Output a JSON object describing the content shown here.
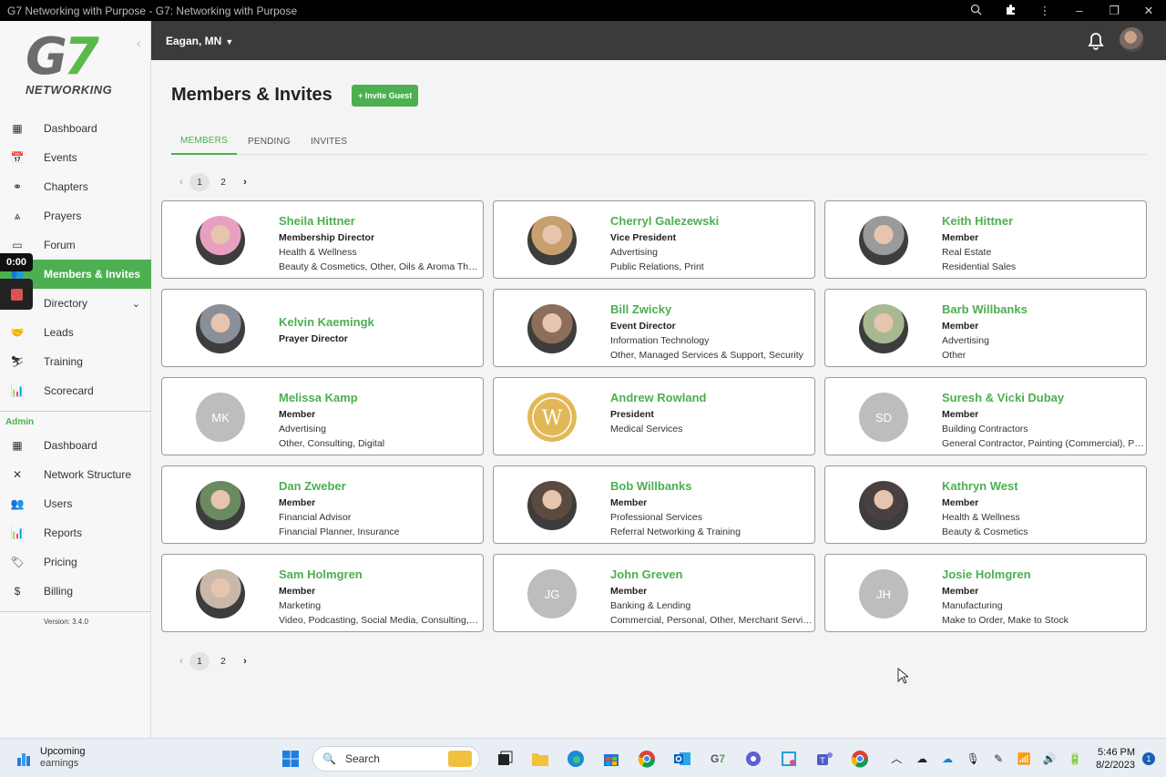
{
  "window": {
    "title": "G7 Networking with Purpose - G7: Networking with Purpose"
  },
  "sidebar": {
    "logo_text": "G7",
    "logo_sub": "NETWORKING",
    "items": [
      {
        "label": "Dashboard",
        "icon": "dashboard-icon"
      },
      {
        "label": "Events",
        "icon": "calendar-icon"
      },
      {
        "label": "Chapters",
        "icon": "chapters-icon"
      },
      {
        "label": "Prayers",
        "icon": "prayer-icon"
      },
      {
        "label": "Forum",
        "icon": "forum-icon"
      },
      {
        "label": "Members & Invites",
        "icon": "members-icon",
        "active": true
      },
      {
        "label": "Directory",
        "icon": "directory-icon"
      },
      {
        "label": "Leads",
        "icon": "handshake-icon"
      },
      {
        "label": "Training",
        "icon": "training-icon"
      },
      {
        "label": "Scorecard",
        "icon": "scorecard-icon"
      }
    ],
    "admin_label": "Admin",
    "admin_items": [
      {
        "label": "Dashboard",
        "icon": "dashboard-icon"
      },
      {
        "label": "Network Structure",
        "icon": "network-icon"
      },
      {
        "label": "Users",
        "icon": "users-icon"
      },
      {
        "label": "Reports",
        "icon": "reports-icon"
      },
      {
        "label": "Pricing",
        "icon": "pricing-icon"
      },
      {
        "label": "Billing",
        "icon": "billing-icon"
      }
    ],
    "version": "Version: 3.4.0"
  },
  "recorder": {
    "timer": "0:00"
  },
  "header": {
    "location": "Eagan, MN"
  },
  "main": {
    "title": "Members & Invites",
    "invite_button": "+ Invite Guest",
    "tabs": [
      "MEMBERS",
      "PENDING",
      "INVITES"
    ],
    "pages": [
      "1",
      "2"
    ],
    "members": [
      {
        "name": "Sheila Hittner",
        "role": "Membership Director",
        "line1": "Health & Wellness",
        "line2": "Beauty & Cosmetics, Other, Oils & Aroma Therapy",
        "avatar": "photo",
        "tone": "#e8a0c0"
      },
      {
        "name": "Cherryl Galezewski",
        "role": "Vice President",
        "line1": "Advertising",
        "line2": "Public Relations, Print",
        "avatar": "photo",
        "tone": "#c8a070"
      },
      {
        "name": "Keith Hittner",
        "role": "Member",
        "line1": "Real Estate",
        "line2": "Residential Sales",
        "avatar": "photo",
        "tone": "#9a9a9a"
      },
      {
        "name": "Kelvin Kaemingk",
        "role": "Prayer Director",
        "line1": "",
        "line2": "",
        "avatar": "photo",
        "tone": "#8a8f98"
      },
      {
        "name": "Bill Zwicky",
        "role": "Event Director",
        "line1": "Information Technology",
        "line2": "Other, Managed Services & Support, Security",
        "avatar": "photo",
        "tone": "#8c6e5a"
      },
      {
        "name": "Barb Willbanks",
        "role": "Member",
        "line1": "Advertising",
        "line2": "Other",
        "avatar": "photo",
        "tone": "#a8b890"
      },
      {
        "name": "Melissa Kamp",
        "role": "Member",
        "line1": "Advertising",
        "line2": "Other, Consulting, Digital",
        "avatar": "initials",
        "initials": "MK"
      },
      {
        "name": "Andrew Rowland",
        "role": "President",
        "line1": "Medical Services",
        "line2": "",
        "avatar": "logo",
        "initials": "W"
      },
      {
        "name": "Suresh & Vicki Dubay",
        "role": "Member",
        "line1": "Building Contractors",
        "line2": "General Contractor, Painting (Commercial), Painting (Residential)",
        "avatar": "initials",
        "initials": "SD"
      },
      {
        "name": "Dan Zweber",
        "role": "Member",
        "line1": "Financial Advisor",
        "line2": "Financial Planner, Insurance",
        "avatar": "photo",
        "tone": "#6a8a60"
      },
      {
        "name": "Bob Willbanks",
        "role": "Member",
        "line1": "Professional Services",
        "line2": "Referral Networking & Training",
        "avatar": "photo",
        "tone": "#5a4a40"
      },
      {
        "name": "Kathryn West",
        "role": "Member",
        "line1": "Health & Wellness",
        "line2": "Beauty & Cosmetics",
        "avatar": "photo",
        "tone": "#4a4040"
      },
      {
        "name": "Sam Holmgren",
        "role": "Member",
        "line1": "Marketing",
        "line2": "Video, Podcasting, Social Media, Consulting, Digital",
        "avatar": "photo",
        "tone": "#c8b8a8"
      },
      {
        "name": "John Greven",
        "role": "Member",
        "line1": "Banking & Lending",
        "line2": "Commercial, Personal, Other, Merchant Services",
        "avatar": "initials",
        "initials": "JG"
      },
      {
        "name": "Josie Holmgren",
        "role": "Member",
        "line1": "Manufacturing",
        "line2": "Make to Order, Make to Stock",
        "avatar": "initials",
        "initials": "JH"
      }
    ]
  },
  "taskbar": {
    "weather_title": "Upcoming",
    "weather_sub": "earnings",
    "search_placeholder": "Search",
    "time": "5:46 PM",
    "date": "8/2/2023",
    "notifications": "1"
  },
  "colors": {
    "accent": "#4caf50",
    "header_bg": "#3b3b3b",
    "initials_bg": "#bdbdbd"
  }
}
